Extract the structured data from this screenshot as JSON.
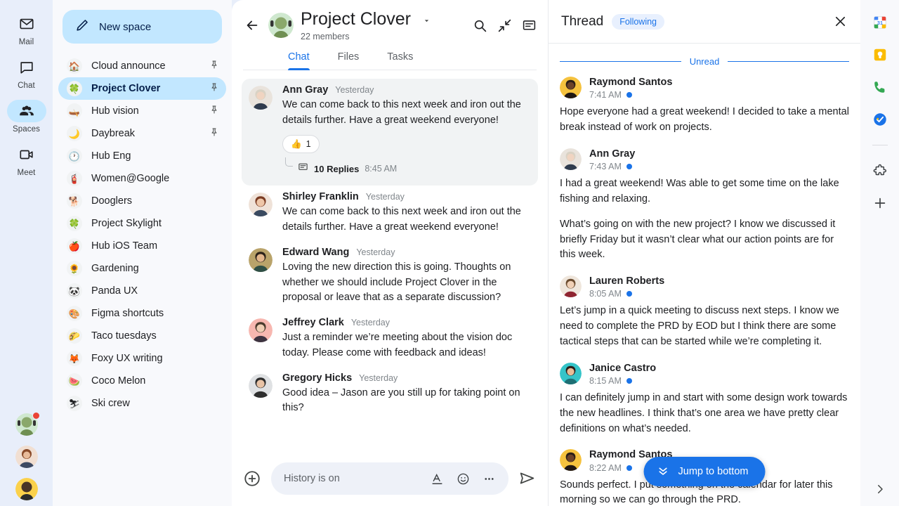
{
  "nav_rail": {
    "items": [
      {
        "label": "Mail",
        "icon": "mail-icon",
        "active": false
      },
      {
        "label": "Chat",
        "icon": "chat-icon",
        "active": false
      },
      {
        "label": "Spaces",
        "icon": "spaces-icon",
        "active": true
      },
      {
        "label": "Meet",
        "icon": "meet-icon",
        "active": false
      }
    ],
    "avatars": [
      {
        "name": "project-clover-avatar",
        "badge": true
      },
      {
        "name": "person-avatar-2",
        "badge": false
      },
      {
        "name": "person-avatar-3",
        "badge": false
      }
    ]
  },
  "spaces": {
    "new_space_label": "New space",
    "new_space_icon": "pencil-icon",
    "items": [
      {
        "emoji": "🏠",
        "name": "Cloud announce",
        "pinned": true,
        "selected": false
      },
      {
        "emoji": "🍀",
        "name": "Project Clover",
        "pinned": true,
        "selected": true
      },
      {
        "emoji": "🛶",
        "name": "Hub vision",
        "pinned": true,
        "selected": false
      },
      {
        "emoji": "🌙",
        "name": "Daybreak",
        "pinned": true,
        "selected": false
      },
      {
        "emoji": "🕐",
        "name": "Hub Eng",
        "pinned": false,
        "selected": false
      },
      {
        "emoji": "🧯",
        "name": "Women@Google",
        "pinned": false,
        "selected": false
      },
      {
        "emoji": "🐕",
        "name": "Dooglers",
        "pinned": false,
        "selected": false
      },
      {
        "emoji": "🍀",
        "name": "Project Skylight",
        "pinned": false,
        "selected": false
      },
      {
        "emoji": "🍎",
        "name": "Hub iOS Team",
        "pinned": false,
        "selected": false
      },
      {
        "emoji": "🌻",
        "name": "Gardening",
        "pinned": false,
        "selected": false
      },
      {
        "emoji": "🐼",
        "name": "Panda UX",
        "pinned": false,
        "selected": false
      },
      {
        "emoji": "🎨",
        "name": "Figma shortcuts",
        "pinned": false,
        "selected": false
      },
      {
        "emoji": "🌮",
        "name": "Taco tuesdays",
        "pinned": false,
        "selected": false
      },
      {
        "emoji": "🦊",
        "name": "Foxy UX writing",
        "pinned": false,
        "selected": false
      },
      {
        "emoji": "🍉",
        "name": "Coco Melon",
        "pinned": false,
        "selected": false
      },
      {
        "emoji": "⛷",
        "name": "Ski crew",
        "pinned": false,
        "selected": false
      }
    ]
  },
  "chat": {
    "back_icon": "back-arrow-icon",
    "room_title": "Project Clover",
    "members": "22 members",
    "dropdown_icon": "chevron-down-icon",
    "actions": [
      {
        "icon": "search-icon"
      },
      {
        "icon": "collapse-icon"
      },
      {
        "icon": "threads-icon"
      }
    ],
    "tabs": [
      {
        "label": "Chat",
        "active": true
      },
      {
        "label": "Files",
        "active": false
      },
      {
        "label": "Tasks",
        "active": false
      }
    ],
    "messages": [
      {
        "author": "Ann Gray",
        "time": "Yesterday",
        "text": "We can come back to this next week and iron out the details further. Have a great weekend everyone!",
        "highlight": true,
        "reaction": {
          "emoji": "👍",
          "count": "1"
        },
        "replies": {
          "count": "10 Replies",
          "time": "8:45 AM",
          "icon": "thread-icon"
        }
      },
      {
        "author": "Shirley Franklin",
        "time": "Yesterday",
        "text": "We can come back to this next week and iron out the details further. Have a great weekend everyone!",
        "highlight": false
      },
      {
        "author": "Edward Wang",
        "time": "Yesterday",
        "text": "Loving the new direction this is going. Thoughts on whether we should include Project Clover in the proposal or leave that as a separate discussion?",
        "highlight": false
      },
      {
        "author": "Jeffrey Clark",
        "time": "Yesterday",
        "text": "Just a reminder we’re meeting about the vision doc today. Please come with feedback and ideas!",
        "highlight": false
      },
      {
        "author": "Gregory Hicks",
        "time": "Yesterday",
        "text": "Good idea – Jason are you still up for taking point on this?",
        "highlight": false
      }
    ],
    "composer": {
      "plus_icon": "add-icon",
      "placeholder": "History is on",
      "format_icon": "format-text-icon",
      "emoji_icon": "emoji-icon",
      "more_icon": "more-options-icon",
      "send_icon": "send-icon"
    }
  },
  "thread": {
    "title": "Thread",
    "following_label": "Following",
    "close_icon": "close-icon",
    "unread_label": "Unread",
    "jump_button": {
      "label": "Jump to bottom",
      "icon": "double-chevron-down-icon"
    },
    "messages": [
      {
        "author": "Raymond Santos",
        "time": "7:41 AM",
        "unread": true,
        "paragraphs": [
          "Hope everyone had a great weekend! I decided to take a mental break instead of work on projects."
        ]
      },
      {
        "author": "Ann Gray",
        "time": "7:43 AM",
        "unread": true,
        "paragraphs": [
          "I had a great weekend! Was able to get some time on the lake fishing and relaxing.",
          "What’s going on with the new project? I know we discussed it briefly Friday but it wasn’t clear what our action points are for this week."
        ]
      },
      {
        "author": "Lauren Roberts",
        "time": "8:05 AM",
        "unread": true,
        "paragraphs": [
          "Let’s jump in a quick meeting to discuss next steps. I know we need to complete the PRD by EOD but I think there are some tactical steps that can be started while we’re completing it."
        ]
      },
      {
        "author": "Janice Castro",
        "time": "8:15 AM",
        "unread": true,
        "paragraphs": [
          "I can definitely jump in and start with some design work towards the new headlines. I think that’s one area we have pretty clear definitions on what’s needed."
        ]
      },
      {
        "author": "Raymond Santos",
        "time": "8:22 AM",
        "unread": true,
        "paragraphs": [
          "Sounds perfect. I put something on the calendar for later this morning so we can go through the PRD."
        ]
      }
    ]
  },
  "right_rail": {
    "items": [
      {
        "icon": "calendar-icon"
      },
      {
        "icon": "keep-icon"
      },
      {
        "icon": "voice-icon"
      },
      {
        "icon": "tasks-icon"
      }
    ],
    "addon_icon": "puzzle-addon-icon",
    "add_icon": "add-icon",
    "expand_icon": "chevron-right-icon"
  },
  "colors": {
    "accent_blue": "#1a73e8",
    "light_blue": "#c2e7ff",
    "rail_bg": "#e8eefa",
    "list_bg": "#f8f9fc",
    "badge_red": "#ea4335"
  }
}
